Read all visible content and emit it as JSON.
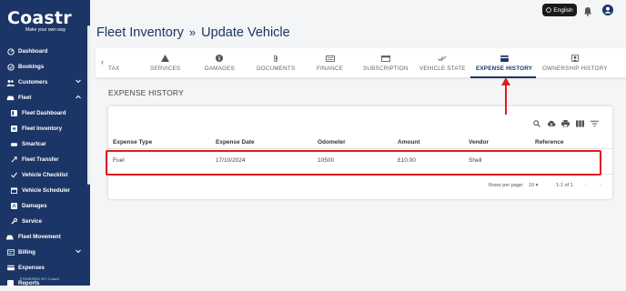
{
  "brand": {
    "name": "Coastr",
    "tagline": "Make your own way",
    "powered_by": "POWERED BY Coastr"
  },
  "sidebar": {
    "items": [
      {
        "label": "Dashboard",
        "icon": "gauge-icon"
      },
      {
        "label": "Bookings",
        "icon": "check-circle-icon"
      },
      {
        "label": "Customers",
        "icon": "people-icon",
        "chevron": "chevron-down-icon"
      },
      {
        "label": "Fleet",
        "icon": "car-icon",
        "chevron": "chevron-up-icon"
      },
      {
        "label": "Fleet Dashboard",
        "icon": "dashboard-icon"
      },
      {
        "label": "Fleet Inventory",
        "icon": "list-icon"
      },
      {
        "label": "Smartcar",
        "icon": "car-small-icon"
      },
      {
        "label": "Fleet Transfer",
        "icon": "transfer-icon"
      },
      {
        "label": "Vehicle Checklist",
        "icon": "checklist-icon"
      },
      {
        "label": "Vehicle Scheduler",
        "icon": "calendar-icon"
      },
      {
        "label": "Damages",
        "icon": "damage-icon"
      },
      {
        "label": "Service",
        "icon": "wrench-icon"
      },
      {
        "label": "Fleet Movement",
        "icon": "movement-icon"
      },
      {
        "label": "Billing",
        "icon": "billing-icon",
        "chevron": "chevron-down-icon"
      },
      {
        "label": "Expenses",
        "icon": "wallet-icon"
      },
      {
        "label": "Reports",
        "icon": "report-icon"
      }
    ]
  },
  "topbar": {
    "language": "English"
  },
  "page": {
    "breadcrumb_parent": "Fleet Inventory",
    "breadcrumb_sep": "»",
    "breadcrumb_current": "Update Vehicle"
  },
  "tabs": [
    {
      "label": "TAX",
      "icon": "tax-icon"
    },
    {
      "label": "SERVICES",
      "icon": "services-icon"
    },
    {
      "label": "DAMAGES",
      "icon": "info-icon"
    },
    {
      "label": "DOCUMENTS",
      "icon": "attachment-icon"
    },
    {
      "label": "FINANCE",
      "icon": "finance-icon"
    },
    {
      "label": "SUBSCRIPTION",
      "icon": "subscription-icon"
    },
    {
      "label": "VEHICLE STATE",
      "icon": "state-icon"
    },
    {
      "label": "EXPENSE HISTORY",
      "icon": "card-icon",
      "active": true
    },
    {
      "label": "OWNERSHIP HISTORY",
      "icon": "ownership-icon"
    }
  ],
  "expense": {
    "section_title": "EXPENSE HISTORY",
    "columns": [
      "Expense Type",
      "Expense Date",
      "Odometer",
      "Amount",
      "Vendor",
      "Reference"
    ],
    "rows": [
      {
        "type": "Fuel",
        "date": "17/10/2024",
        "odometer": "10500",
        "amount": "£10.00",
        "vendor": "Shell",
        "reference": ""
      }
    ],
    "pager": {
      "rows_per_page_label": "Rows per page:",
      "rows_per_page": "10",
      "range": "1-1 of 1"
    }
  },
  "colors": {
    "sidebar": "#1b3566",
    "accent": "#1b3566",
    "highlight": "#e11c1c"
  }
}
